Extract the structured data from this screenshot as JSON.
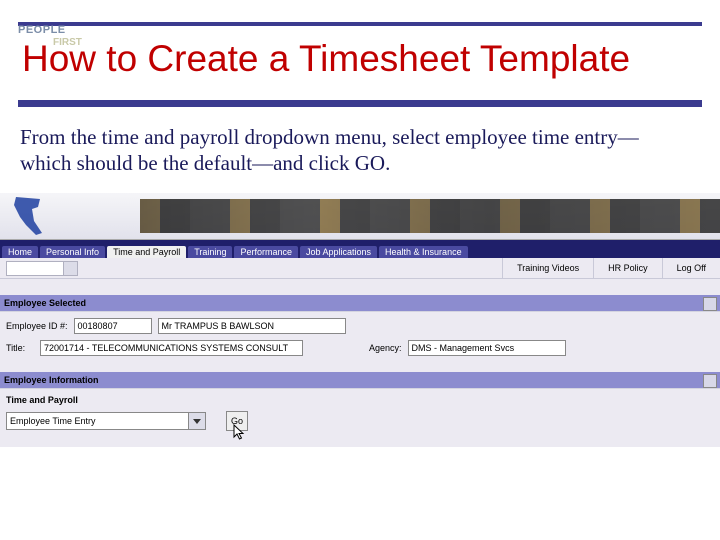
{
  "header": {
    "logo_line1": "PEOPLE",
    "logo_line2": "FIRST",
    "title": "How to Create a Timesheet Template"
  },
  "body": {
    "paragraph": "From the time and payroll dropdown menu, select employee time entry—which should be the default—and click GO."
  },
  "app": {
    "tabs": [
      "Home",
      "Personal Info",
      "Time and Payroll",
      "Training",
      "Performance",
      "Job Applications",
      "Health & Insurance"
    ],
    "active_tab_index": 2,
    "sublinks": [
      "Training Videos",
      "HR Policy",
      "Log Off"
    ],
    "section_employee_selected": "Employee Selected",
    "employee": {
      "id_label": "Employee ID #:",
      "id_value": "00180807",
      "name_value": "Mr TRAMPUS B BAWLSON",
      "title_label": "Title:",
      "title_value": "72001714 - TELECOMMUNICATIONS SYSTEMS CONSULT",
      "agency_label": "Agency:",
      "agency_value": "DMS - Management Svcs"
    },
    "section_employee_info": "Employee Information",
    "section_time_payroll": "Time and Payroll",
    "dropdown_value": "Employee Time Entry",
    "go_label": "Go"
  }
}
